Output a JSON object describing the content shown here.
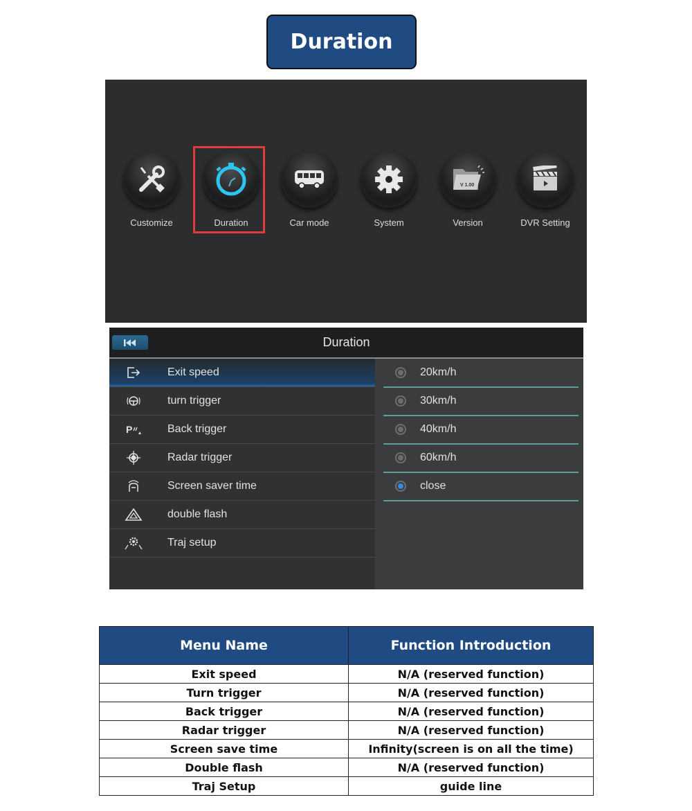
{
  "heading": {
    "title": "Duration"
  },
  "home": {
    "apps": [
      {
        "label": "Customize",
        "icon": "tools-icon"
      },
      {
        "label": "Duration",
        "icon": "stopwatch-icon",
        "highlighted": true
      },
      {
        "label": "Car mode",
        "icon": "bus-icon"
      },
      {
        "label": "System",
        "icon": "gear-icon"
      },
      {
        "label": "Version",
        "icon": "folder-version-icon",
        "badge": "V 1.00"
      },
      {
        "label": "DVR Setting",
        "icon": "clapperboard-icon"
      }
    ],
    "highlight_color": "#e23b3b"
  },
  "settings": {
    "title": "Duration",
    "back_icon": "skip-back-icon",
    "menu": [
      {
        "label": "Exit speed",
        "icon": "exit-icon",
        "active": true
      },
      {
        "label": "turn trigger",
        "icon": "steering-wheel-icon"
      },
      {
        "label": "Back trigger",
        "icon": "parking-sensor-icon"
      },
      {
        "label": "Radar trigger",
        "icon": "crosshair-icon"
      },
      {
        "label": "Screen saver time",
        "icon": "screen-saver-icon"
      },
      {
        "label": "double flash",
        "icon": "hazard-triangle-icon"
      },
      {
        "label": "Traj setup",
        "icon": "trajectory-gear-icon"
      }
    ],
    "options": [
      {
        "label": "20km/h",
        "selected": false
      },
      {
        "label": "30km/h",
        "selected": false
      },
      {
        "label": "40km/h",
        "selected": false
      },
      {
        "label": "60km/h",
        "selected": false
      },
      {
        "label": "close",
        "selected": true
      }
    ]
  },
  "table": {
    "headers": [
      "Menu Name",
      "Function Introduction"
    ],
    "rows": [
      [
        "Exit speed",
        "N/A (reserved function)"
      ],
      [
        "Turn trigger",
        "N/A (reserved function)"
      ],
      [
        "Back trigger",
        "N/A (reserved function)"
      ],
      [
        "Radar trigger",
        "N/A (reserved function)"
      ],
      [
        "Screen save time",
        "Infinity(screen is on all the time)"
      ],
      [
        "Double flash",
        "N/A (reserved function)"
      ],
      [
        "Traj Setup",
        "guide line"
      ]
    ]
  },
  "colors": {
    "brand_blue": "#1f4a82",
    "accent_cyan": "#2ec4f0",
    "radio_selected": "#2d8ae6"
  }
}
